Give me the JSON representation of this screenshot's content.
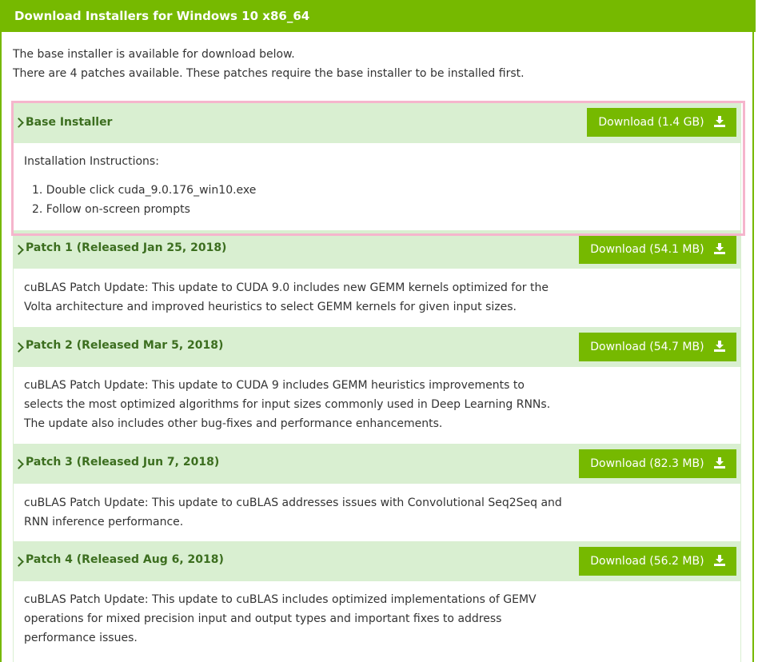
{
  "header": {
    "title": "Download Installers for Windows 10 x86_64"
  },
  "intro": {
    "line1": "The base installer is available for download below.",
    "line2": "There are 4 patches available. These patches require the base installer to be installed first."
  },
  "base": {
    "title": "Base Installer",
    "button": "Download (1.4 GB)",
    "instructions_label": "Installation Instructions:",
    "steps": [
      "1. Double click cuda_9.0.176_win10.exe",
      "2. Follow on-screen prompts"
    ]
  },
  "patches": [
    {
      "title": "Patch 1 (Released Jan 25, 2018)",
      "button": "Download (54.1 MB)",
      "lines": [
        "cuBLAS Patch Update: This update to CUDA 9.0 includes new GEMM kernels optimized for the",
        "Volta architecture and improved heuristics to select GEMM kernels for given input sizes."
      ]
    },
    {
      "title": "Patch 2 (Released Mar 5, 2018)",
      "button": "Download (54.7 MB)",
      "lines": [
        "cuBLAS Patch Update: This update to CUDA 9 includes GEMM heuristics improvements to",
        "selects the most optimized algorithms for input sizes commonly used in Deep Learning RNNs.",
        "The update also includes other bug-fixes and performance enhancements."
      ]
    },
    {
      "title": "Patch 3 (Released Jun 7, 2018)",
      "button": "Download (82.3 MB)",
      "lines": [
        "cuBLAS Patch Update: This update to cuBLAS addresses issues with Convolutional Seq2Seq and",
        "RNN inference performance."
      ]
    },
    {
      "title": "Patch 4 (Released Aug 6, 2018)",
      "button": "Download (56.2 MB)",
      "lines": [
        "cuBLAS Patch Update: This update to cuBLAS includes optimized implementations of GEMV",
        "operations for mixed precision input and output types and important fixes to address",
        "performance issues."
      ]
    }
  ],
  "colors": {
    "accent": "#76b900",
    "section_bg": "#d9efd1",
    "title_text": "#3c6e1f",
    "highlight": "#f5b5cc"
  }
}
